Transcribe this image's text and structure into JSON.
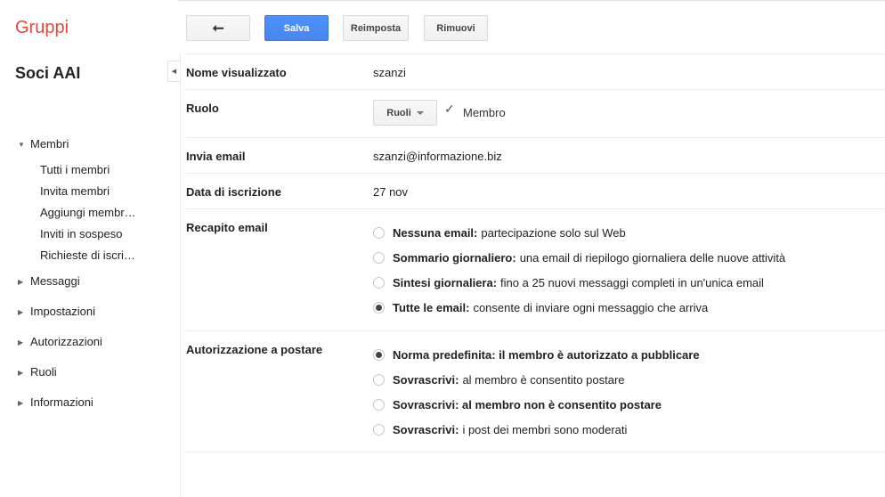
{
  "app": {
    "title": "Gruppi",
    "group_name": "Soci AAI"
  },
  "toolbar": {
    "back_symbol": "⭠",
    "save_label": "Salva",
    "reset_label": "Reimposta",
    "remove_label": "Rimuovi"
  },
  "collapse_symbol": "◀",
  "nav": {
    "members": {
      "label": "Membri",
      "children": [
        "Tutti i membri",
        "Invita membri",
        "Aggiungi membr…",
        "Inviti in sospeso",
        "Richieste di iscri…"
      ]
    },
    "sections": [
      "Messaggi",
      "Impostazioni",
      "Autorizzazioni",
      "Ruoli",
      "Informazioni"
    ]
  },
  "form": {
    "display_name": {
      "label": "Nome visualizzato",
      "value": "szanzi"
    },
    "role": {
      "label": "Ruolo",
      "button": "Ruoli",
      "check_symbol": "✓",
      "value": "Membro"
    },
    "email": {
      "label": "Invia email",
      "value": "szanzi@informazione.biz"
    },
    "joined": {
      "label": "Data di iscrizione",
      "value": "27 nov"
    },
    "delivery": {
      "label": "Recapito email",
      "options": [
        {
          "title": "Nessuna email:",
          "text": "partecipazione solo sul Web",
          "selected": false
        },
        {
          "title": "Sommario giornaliero:",
          "text": "una email di riepilogo giornaliera delle nuove attività",
          "selected": false
        },
        {
          "title": "Sintesi giornaliera:",
          "text": "fino a 25 nuovi messaggi completi in un'unica email",
          "selected": false
        },
        {
          "title": "Tutte le email:",
          "text": "consente di inviare ogni messaggio che arriva",
          "selected": true
        }
      ]
    },
    "posting": {
      "label": "Autorizzazione a postare",
      "options": [
        {
          "title": "Norma predefinita: il membro è autorizzato a pubblicare",
          "text": "",
          "selected": true
        },
        {
          "title": "Sovrascrivi:",
          "text": "al membro è consentito postare",
          "selected": false
        },
        {
          "title": "Sovrascrivi: al membro non è consentito postare",
          "text": "",
          "selected": false
        },
        {
          "title": "Sovrascrivi:",
          "text": "i post dei membri sono moderati",
          "selected": false
        }
      ]
    }
  }
}
